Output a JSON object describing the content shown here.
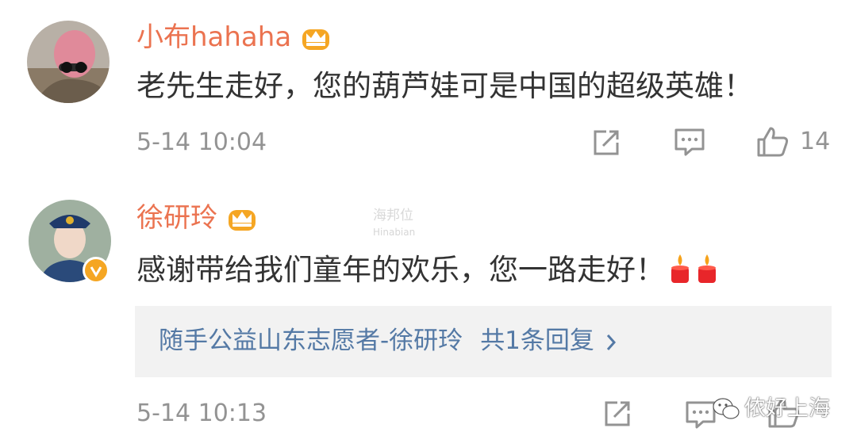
{
  "comments": [
    {
      "username": "小布hahaha",
      "text": "老先生走好，您的葫芦娃可是中国的超级英雄！",
      "time": "5-14 10:04",
      "like_count": "14"
    },
    {
      "username": "徐研玲",
      "text": "感谢带给我们童年的欢乐，您一路走好！",
      "time": "5-14 10:13",
      "reply_author": "随手公益山东志愿者-徐研玲",
      "reply_count": "共1条回复"
    }
  ],
  "watermarks": {
    "faint_logo": "海邦位",
    "faint_logo_sub": "Hinabian",
    "brand": "侬好上海"
  },
  "colors": {
    "username": "#eb7350",
    "text": "#333333",
    "meta": "#939393",
    "link": "#5479a5",
    "reply_bg": "#f2f2f2",
    "crown": "#f5a623",
    "candle": "#e8262a"
  },
  "icons": [
    "crown-icon",
    "share-icon",
    "comment-icon",
    "thumbs-up-icon",
    "verified-badge-icon",
    "candle-icon",
    "chevron-right-icon",
    "wechat-icon"
  ]
}
